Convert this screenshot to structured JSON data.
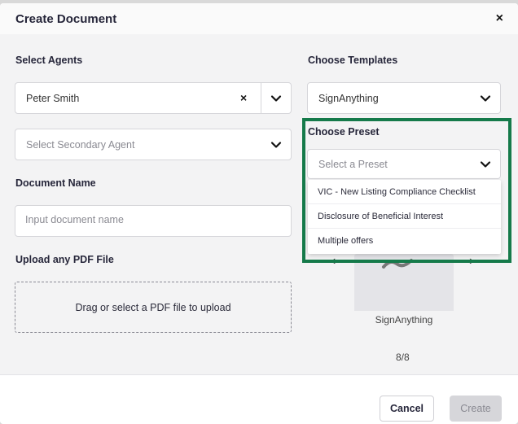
{
  "dialog": {
    "title": "Create Document",
    "close_symbol": "×"
  },
  "agents": {
    "label": "Select Agents",
    "primary_value": "Peter Smith",
    "clear_symbol": "×",
    "secondary_placeholder": "Select Secondary Agent"
  },
  "document_name": {
    "label": "Document Name",
    "placeholder": "Input document name"
  },
  "upload": {
    "label": "Upload any PDF File",
    "dropzone_text": "Drag or select a PDF file to upload"
  },
  "templates": {
    "label": "Choose Templates",
    "selected": "SignAnything"
  },
  "preset": {
    "label": "Choose Preset",
    "placeholder": "Select a Preset",
    "options": [
      "VIC - New Listing Compliance Checklist",
      "Disclosure of Beneficial Interest",
      "Multiple offers"
    ]
  },
  "preview": {
    "caption": "SignAnything",
    "page_indicator": "8/8",
    "prev_symbol": "‹",
    "next_symbol": "›"
  },
  "footer": {
    "cancel_label": "Cancel",
    "create_label": "Create"
  },
  "colors": {
    "highlight": "#157a4a",
    "create_disabled_bg": "#d6d6da"
  }
}
